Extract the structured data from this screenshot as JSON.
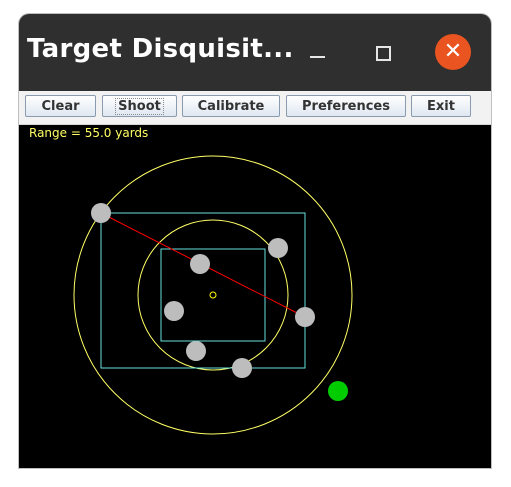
{
  "window": {
    "title": "Target Disquisit...",
    "controls": {
      "minimize": "minimize-icon",
      "maximize": "maximize-icon",
      "close": "close-icon"
    },
    "close_color": "#e95420",
    "close_glyph": "✕"
  },
  "toolbar": {
    "buttons": [
      {
        "label": "Clear"
      },
      {
        "label": "Shoot",
        "focused": true
      },
      {
        "label": "Calibrate"
      },
      {
        "label": "Preferences"
      },
      {
        "label": "Exit"
      }
    ]
  },
  "target": {
    "range_text": "Range = 55.0 yards",
    "background": "#000000",
    "ring_color": "#ffff66",
    "box_color": "#66e0e0",
    "spread_line_color": "#ff0000",
    "shot_color": "#bdbdbd",
    "marker_color": "#00cc00",
    "center_marker_color": "#ffff00"
  }
}
